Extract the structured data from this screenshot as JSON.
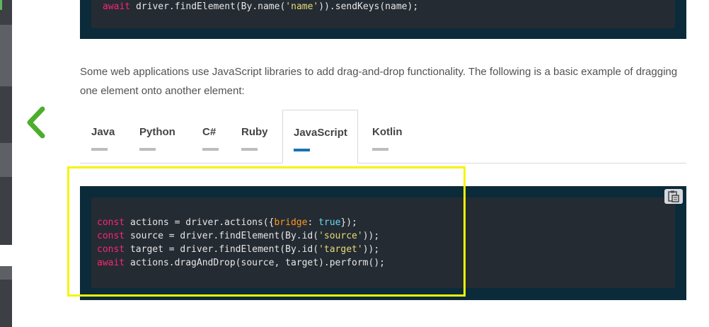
{
  "top_code": {
    "line": {
      "kw": "await",
      "a": " driver.findElement(By.name(",
      "s": "'name'",
      "b": ")).sendKeys(name);"
    }
  },
  "paragraph": "Some web applications use JavaScript libraries to add drag-and-drop functionality. The following is a basic example of dragging one element onto another element:",
  "tabs": [
    {
      "label": "Java"
    },
    {
      "label": "Python"
    },
    {
      "label": "C#"
    },
    {
      "label": "Ruby"
    },
    {
      "label": "JavaScript",
      "active": true
    },
    {
      "label": "Kotlin"
    }
  ],
  "code": {
    "line1": {
      "kw": "const",
      "a": " actions = driver.actions({",
      "p": "bridge",
      "b": ": ",
      "lit": "true",
      "c": "});"
    },
    "line2": {
      "kw": "const",
      "a": " source = driver.findElement(By.id(",
      "s": "'source'",
      "b": "));"
    },
    "line3": {
      "kw": "const",
      "a": " target = driver.findElement(By.id(",
      "s": "'target'",
      "b": "));"
    },
    "line4": {
      "kw": "await",
      "a": " actions.dragAndDrop(source, target).perform();"
    }
  },
  "icons": {
    "prev": "chevron-left-icon",
    "copy": "clipboard-icon"
  },
  "colors": {
    "accent_green": "#4cae2c",
    "tab_active": "#1a73b5",
    "code_bg": "#252b33",
    "code_frame": "#0b2b3a",
    "highlight": "#f5f50a"
  }
}
